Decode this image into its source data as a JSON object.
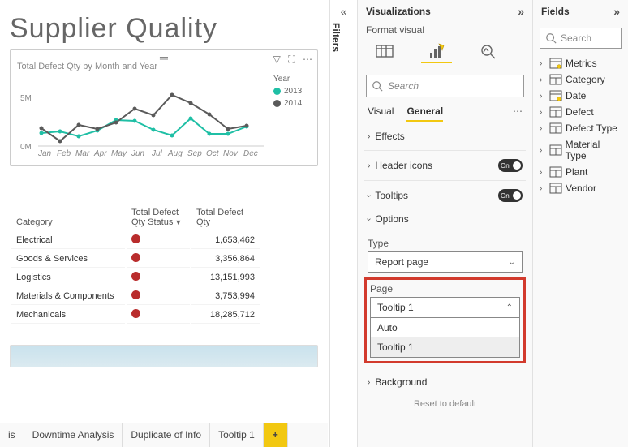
{
  "report": {
    "title": "Supplier Quality"
  },
  "chart": {
    "title": "Total Defect Qty by Month and Year",
    "legend_title": "Year",
    "series_a": "2013",
    "series_b": "2014",
    "color_a": "#1fbfa5",
    "color_b": "#5a5a5a",
    "y0": "0M",
    "y1": "5M",
    "months": [
      "Jan",
      "Feb",
      "Mar",
      "Apr",
      "May",
      "Jun",
      "Jul",
      "Aug",
      "Sep",
      "Oct",
      "Nov",
      "Dec"
    ]
  },
  "chart_data": {
    "type": "line",
    "title": "Total Defect Qty by Month and Year",
    "xlabel": "",
    "ylabel": "",
    "ylim": [
      0,
      6000000
    ],
    "categories": [
      "Jan",
      "Feb",
      "Mar",
      "Apr",
      "May",
      "Jun",
      "Jul",
      "Aug",
      "Sep",
      "Oct",
      "Nov",
      "Dec"
    ],
    "series": [
      {
        "name": "2013",
        "color": "#1fbfa5",
        "values": [
          1400000,
          1600000,
          1200000,
          1700000,
          2700000,
          2600000,
          1800000,
          1200000,
          2800000,
          1400000,
          1400000,
          2000000
        ]
      },
      {
        "name": "2014",
        "color": "#5a5a5a",
        "values": [
          1900000,
          600000,
          2200000,
          1800000,
          2400000,
          3800000,
          3100000,
          5200000,
          4300000,
          3200000,
          1800000,
          2100000
        ]
      }
    ]
  },
  "table": {
    "h1": "Category",
    "h2": "Total Defect Qty Status",
    "h3": "Total Defect Qty",
    "rows": [
      {
        "c": "Electrical",
        "v": "1,653,462"
      },
      {
        "c": "Goods & Services",
        "v": "3,356,864"
      },
      {
        "c": "Logistics",
        "v": "13,151,993"
      },
      {
        "c": "Materials & Components",
        "v": "3,753,994"
      },
      {
        "c": "Mechanicals",
        "v": "18,285,712"
      }
    ]
  },
  "tabs": {
    "t0": "is",
    "t1": "Downtime Analysis",
    "t2": "Duplicate of Info",
    "t3": "Tooltip 1",
    "add": "+"
  },
  "filters": {
    "label": "Filters"
  },
  "viz": {
    "title": "Visualizations",
    "format": "Format visual",
    "search": "Search",
    "sub_visual": "Visual",
    "sub_general": "General",
    "effects": "Effects",
    "header_icons": "Header icons",
    "tooltips": "Tooltips",
    "options": "Options",
    "type_label": "Type",
    "type_value": "Report page",
    "page_label": "Page",
    "page_value": "Tooltip 1",
    "opt_auto": "Auto",
    "opt_tooltip1": "Tooltip 1",
    "background": "Background",
    "on": "On",
    "reset": "Reset to default"
  },
  "fields": {
    "title": "Fields",
    "search": "Search",
    "items": [
      "Metrics",
      "Category",
      "Date",
      "Defect",
      "Defect Type",
      "Material Type",
      "Plant",
      "Vendor"
    ]
  }
}
